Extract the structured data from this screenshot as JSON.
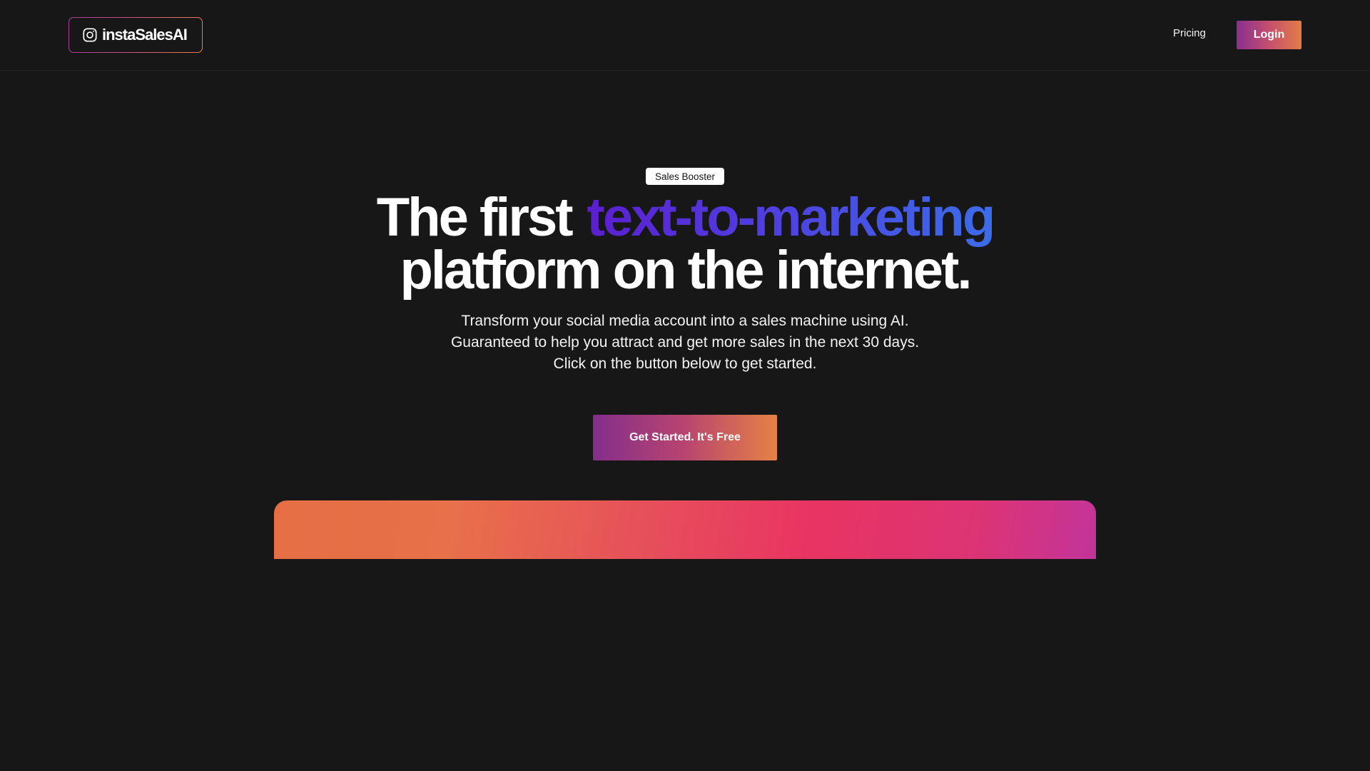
{
  "header": {
    "logo": {
      "icon": "instagram-icon",
      "text": "instaSalesAI",
      "border_gradient": [
        "#a23fa0",
        "#e8814a"
      ]
    },
    "nav": {
      "pricing_label": "Pricing"
    },
    "login_label": "Login"
  },
  "hero": {
    "badge": "Sales Booster",
    "headline": {
      "prefix": "The first",
      "accent": "text-to-marketing",
      "line2": "platform on the internet."
    },
    "subtitle": "Transform your social media account into a sales machine using AI. Guaranteed to help you attract and get more sales in the next 30 days. Click on the button below to get started.",
    "cta_label": "Get Started. It's Free"
  },
  "colors": {
    "background": "#171717",
    "accent_gradient": [
      "#5b1fd0",
      "#3c6ce8"
    ],
    "button_gradient": [
      "#842e8b",
      "#e68145"
    ],
    "showcase_gradient": [
      "#e66e44",
      "#e83462",
      "#c2349a"
    ]
  }
}
